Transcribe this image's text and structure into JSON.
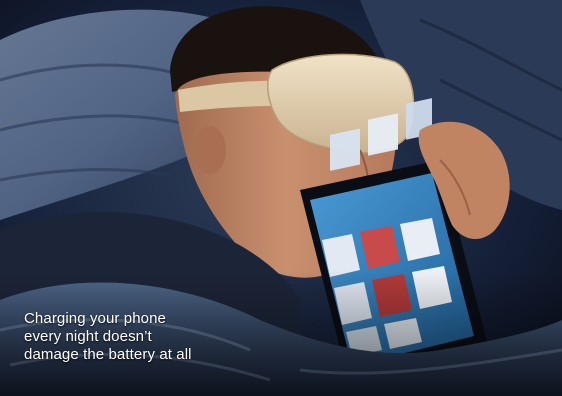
{
  "caption": {
    "lines": [
      "Charging your phone",
      "every night doesn’t",
      "damage the battery at all"
    ]
  },
  "colors": {
    "background_dark": "#0e1626",
    "bedding_blue": "#3e5677",
    "pillow_light": "#8a9db8",
    "skin": "#c98d6c",
    "hair": "#1a120e",
    "mask": "#e5d3b4",
    "tablet_screen": "#2f7fc0",
    "caption_text": "#ffffff"
  },
  "icons": [
    "sleeping-man-photo",
    "sleep-mask",
    "tablet-device"
  ]
}
